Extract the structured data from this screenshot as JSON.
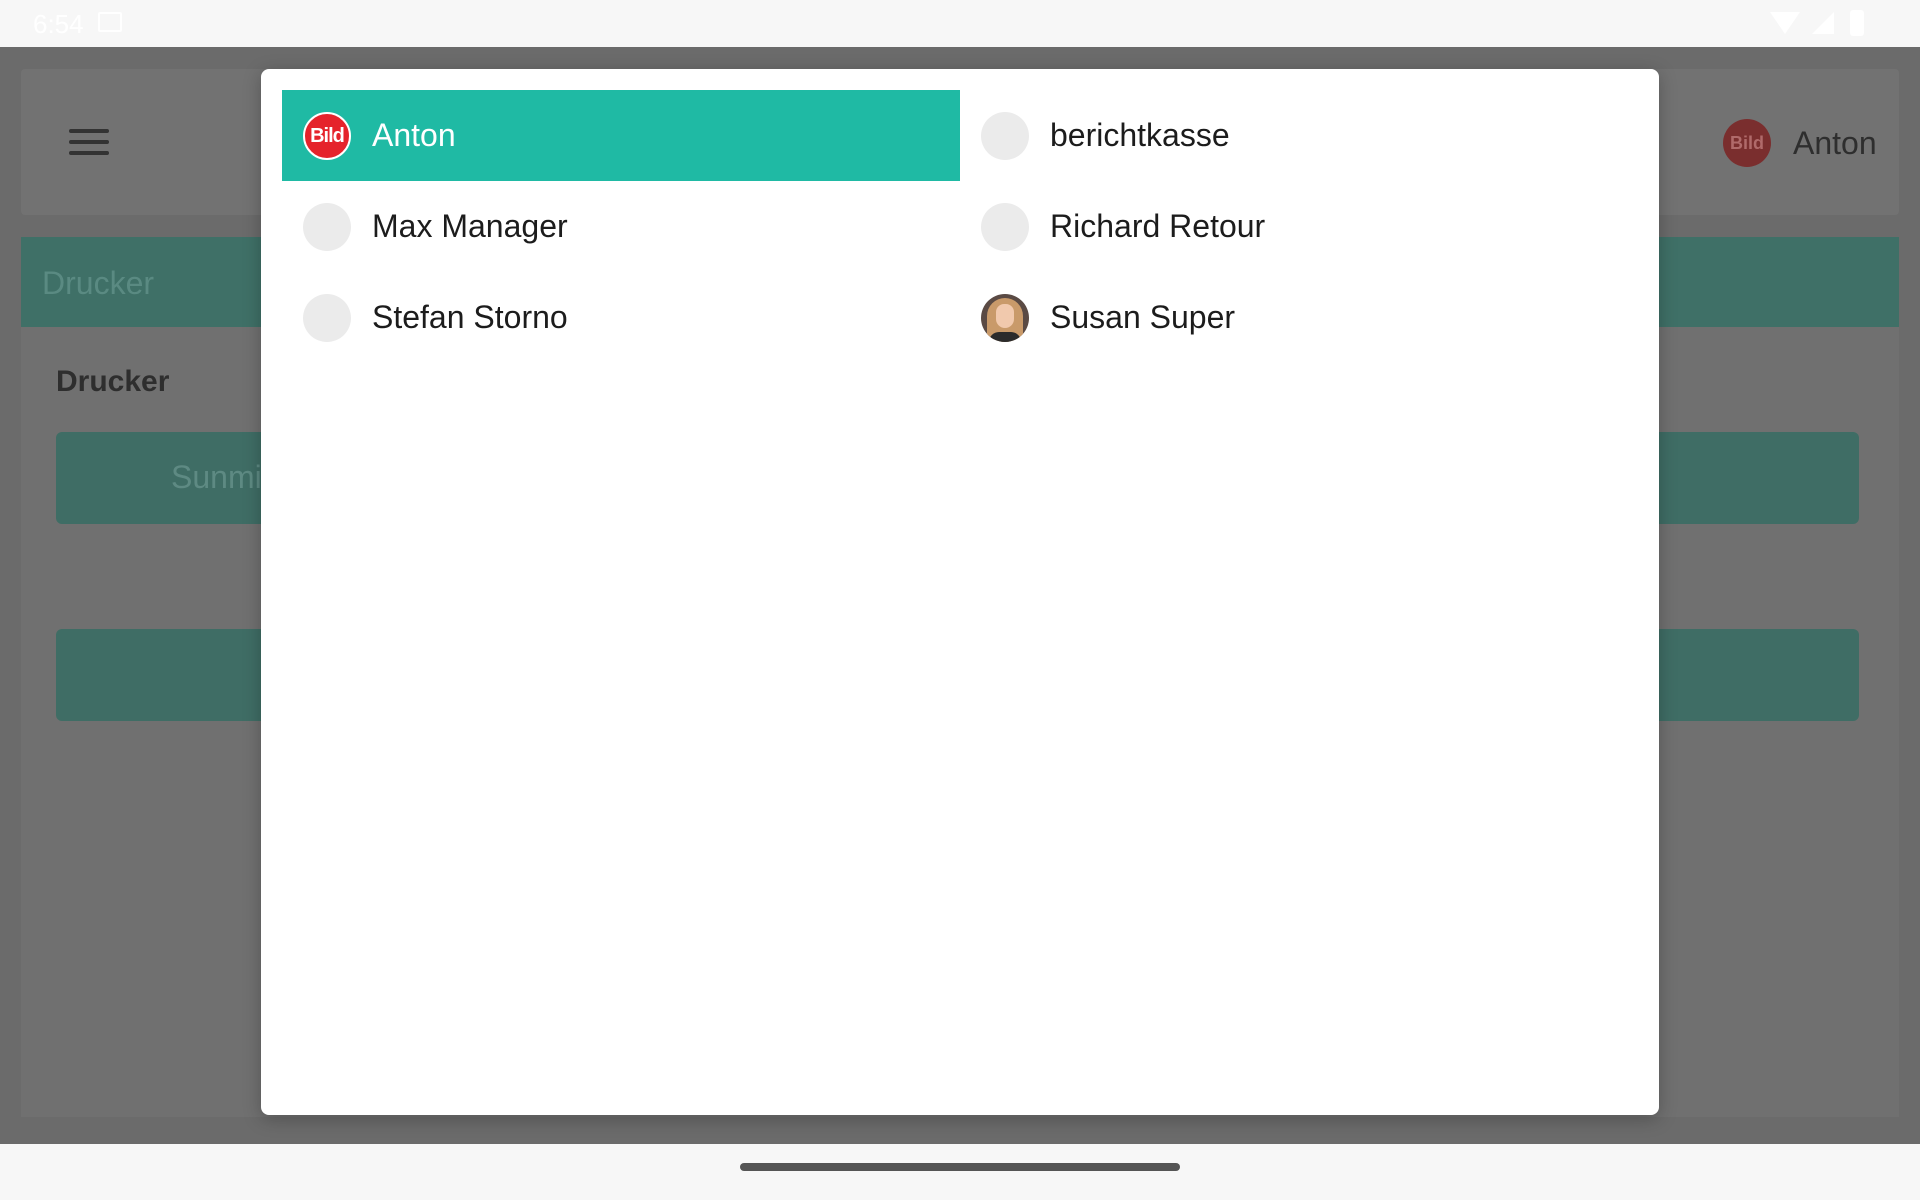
{
  "status_bar": {
    "time": "6:54",
    "icons": [
      "screen-icon",
      "wifi-icon",
      "signal-icon",
      "battery-icon"
    ]
  },
  "background_app": {
    "header": {
      "menu_icon": "menu-icon",
      "current_user": "Anton"
    },
    "section_title": "Drucker",
    "card_label": "Drucker",
    "printer_button_label": "Sunmi"
  },
  "user_dialog": {
    "selected_user": "Anton",
    "users": [
      {
        "name": "Anton",
        "avatar": "bild-logo",
        "avatar_text": "Bild"
      },
      {
        "name": "berichtkasse",
        "avatar": "placeholder"
      },
      {
        "name": "Max Manager",
        "avatar": "placeholder"
      },
      {
        "name": "Richard Retour",
        "avatar": "placeholder"
      },
      {
        "name": "Stefan Storno",
        "avatar": "placeholder"
      },
      {
        "name": "Susan Super",
        "avatar": "photo"
      }
    ]
  },
  "colors": {
    "accent": "#1fbaa4",
    "dialog_background": "#ffffff",
    "scrim": "#6b6b6b",
    "placeholder_avatar": "#ebebeb",
    "bild_red": "#e5232b"
  }
}
